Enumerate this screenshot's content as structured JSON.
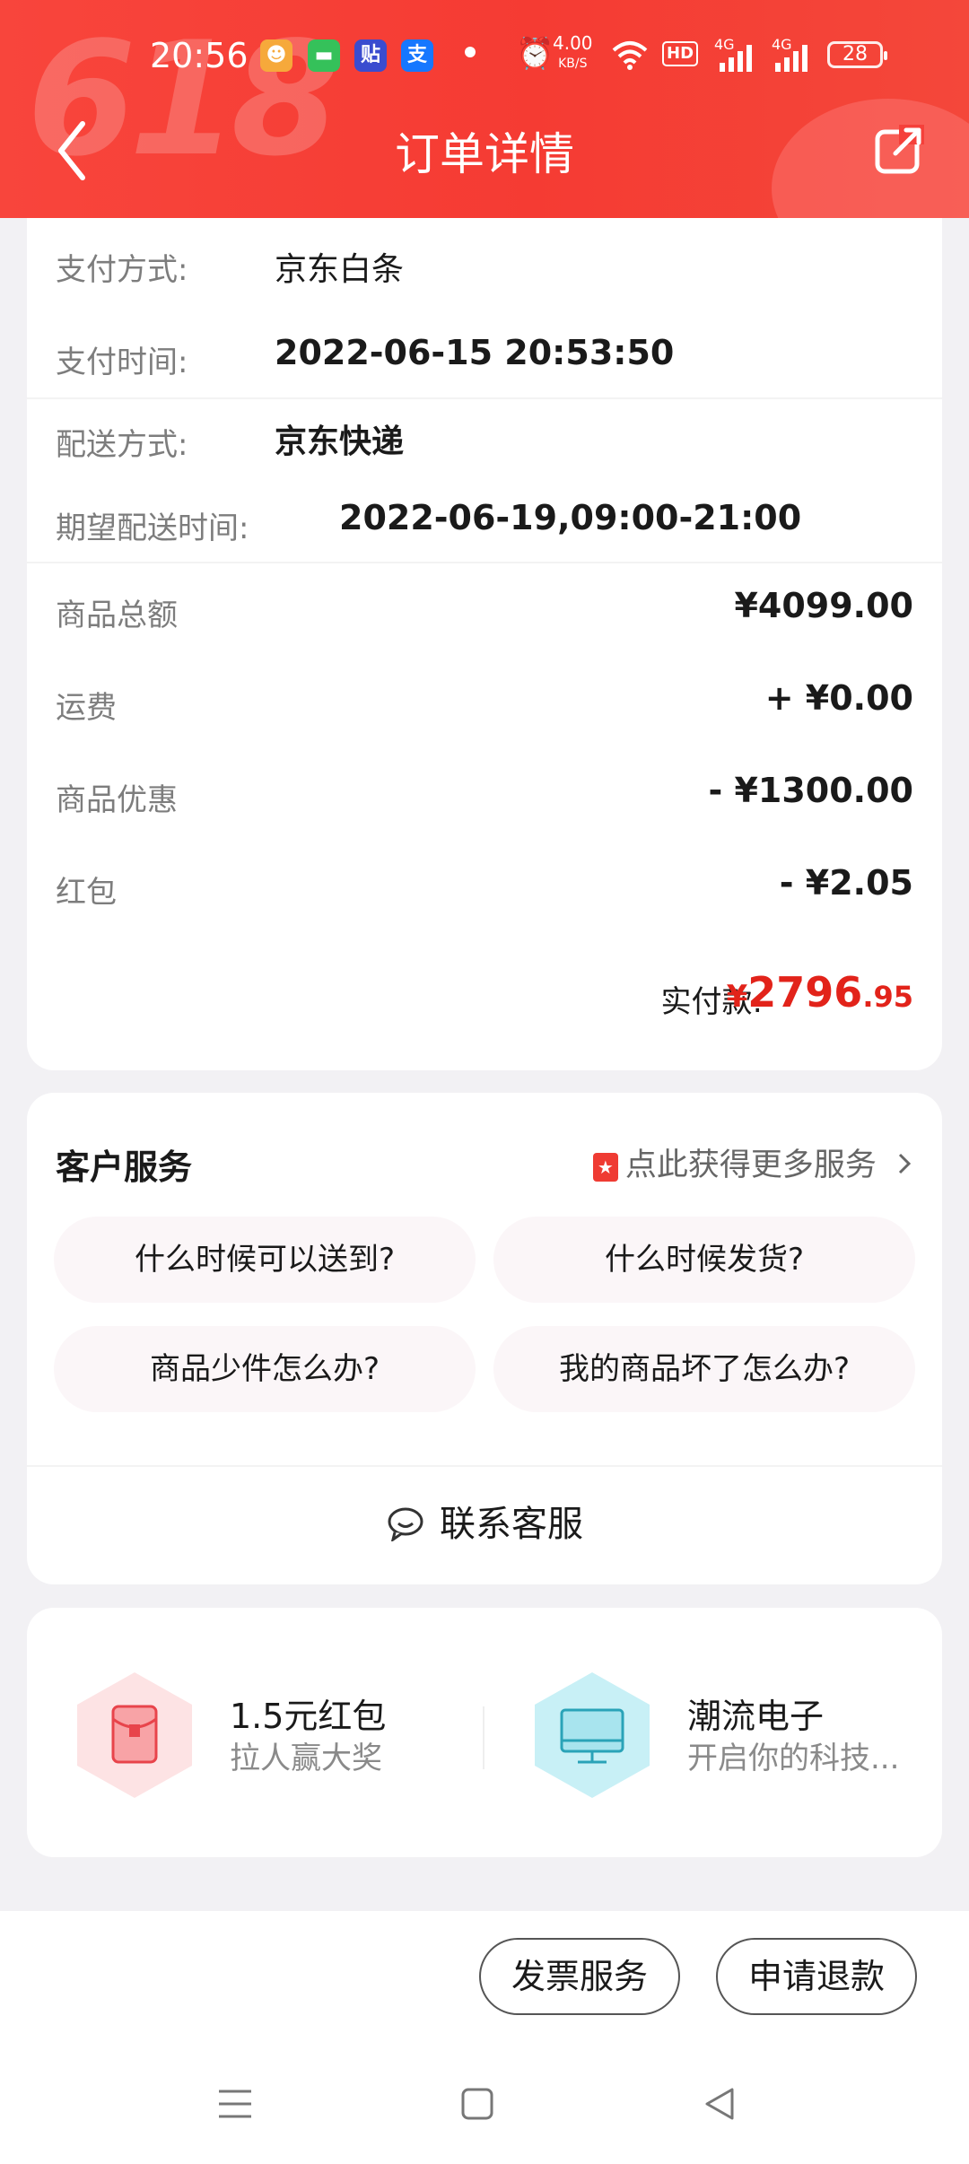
{
  "status_bar": {
    "time": "20:56",
    "net_speed": "4.00",
    "net_speed_unit": "KB/S",
    "hd_badge": "HD",
    "signal_1": "4G",
    "signal_2": "4G",
    "battery": "28",
    "app_icons": [
      "emoji-app-icon",
      "message-app-icon",
      "tieba-app-icon",
      "alipay-app-icon"
    ],
    "alipay_glyph": "支",
    "tieba_glyph": "贴"
  },
  "header": {
    "title": "订单详情",
    "deco_text": "618",
    "bg_color": "#f5403a"
  },
  "order_info": {
    "rows": [
      {
        "label": "支付方式:",
        "value": "京东白条"
      },
      {
        "label": "支付时间:",
        "value": "2022-06-15 20:53:50"
      },
      {
        "label": "配送方式:",
        "value": "京东快递"
      },
      {
        "label": "期望配送时间:",
        "value": "2022-06-19,09:00-21:00"
      }
    ]
  },
  "amounts": {
    "rows": [
      {
        "label": "商品总额",
        "value": "¥4099.00"
      },
      {
        "label": "运费",
        "value": "+ ¥0.00"
      },
      {
        "label": "商品优惠",
        "value": "- ¥1300.00"
      },
      {
        "label": "红包",
        "value": "- ¥2.05"
      }
    ],
    "paid_label": "实付款:",
    "paid_currency": "¥",
    "paid_integer": "2796",
    "paid_decimal": ".95",
    "paid_color": "#e2231a"
  },
  "customer_service": {
    "title": "客户服务",
    "more_label": "点此获得更多服务",
    "faqs": [
      "什么时候可以送到?",
      "什么时候发货?",
      "商品少件怎么办?",
      "我的商品坏了怎么办?"
    ],
    "contact_label": "联系客服"
  },
  "promos": [
    {
      "title": "1.5元红包",
      "subtitle": "拉人赢大奖",
      "icon": "red-envelope-icon"
    },
    {
      "title": "潮流电子",
      "subtitle": "开启你的科技...",
      "icon": "monitor-icon"
    }
  ],
  "bottom_bar": {
    "invoice_button": "发票服务",
    "refund_button": "申请退款"
  }
}
